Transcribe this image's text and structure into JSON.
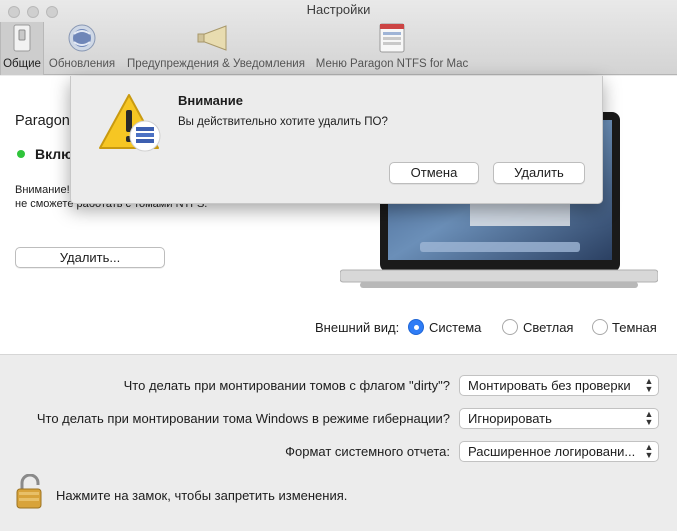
{
  "window": {
    "title": "Настройки"
  },
  "toolbar": {
    "tabs": [
      {
        "label": "Общие",
        "icon": "switch-icon"
      },
      {
        "label": "Обновления",
        "icon": "update-globe-icon"
      },
      {
        "label": "Предупреждения & Уведомления",
        "icon": "megaphone-icon"
      },
      {
        "label": "Меню Paragon NTFS for Mac",
        "icon": "menu-list-icon"
      }
    ]
  },
  "general": {
    "product_name": "Paragon",
    "status": "Включ",
    "warning": "Внимание!\nне сможете работать с томами NTFS.",
    "uninstall_button": "Удалить..."
  },
  "appearance": {
    "label": "Внешний вид:",
    "options": [
      "Система",
      "Светлая",
      "Темная"
    ],
    "selected": "Система",
    "accent": "#2e7cf6"
  },
  "options": {
    "dirty_label": "Что делать при монтировании томов с флагом \"dirty\"?",
    "dirty_value": "Монтировать без проверки",
    "hibernate_label": "Что делать при монтировании тома Windows в режиме гибернации?",
    "hibernate_value": "Игнорировать",
    "report_label": "Формат системного отчета:",
    "report_value": "Расширенное логировани..."
  },
  "lock": {
    "text": "Нажмите на замок, чтобы запретить изменения."
  },
  "dialog": {
    "title": "Внимание",
    "message": "Вы действительно хотите удалить ПО?",
    "cancel": "Отмена",
    "confirm": "Удалить"
  },
  "status_color": "#2fc43b"
}
